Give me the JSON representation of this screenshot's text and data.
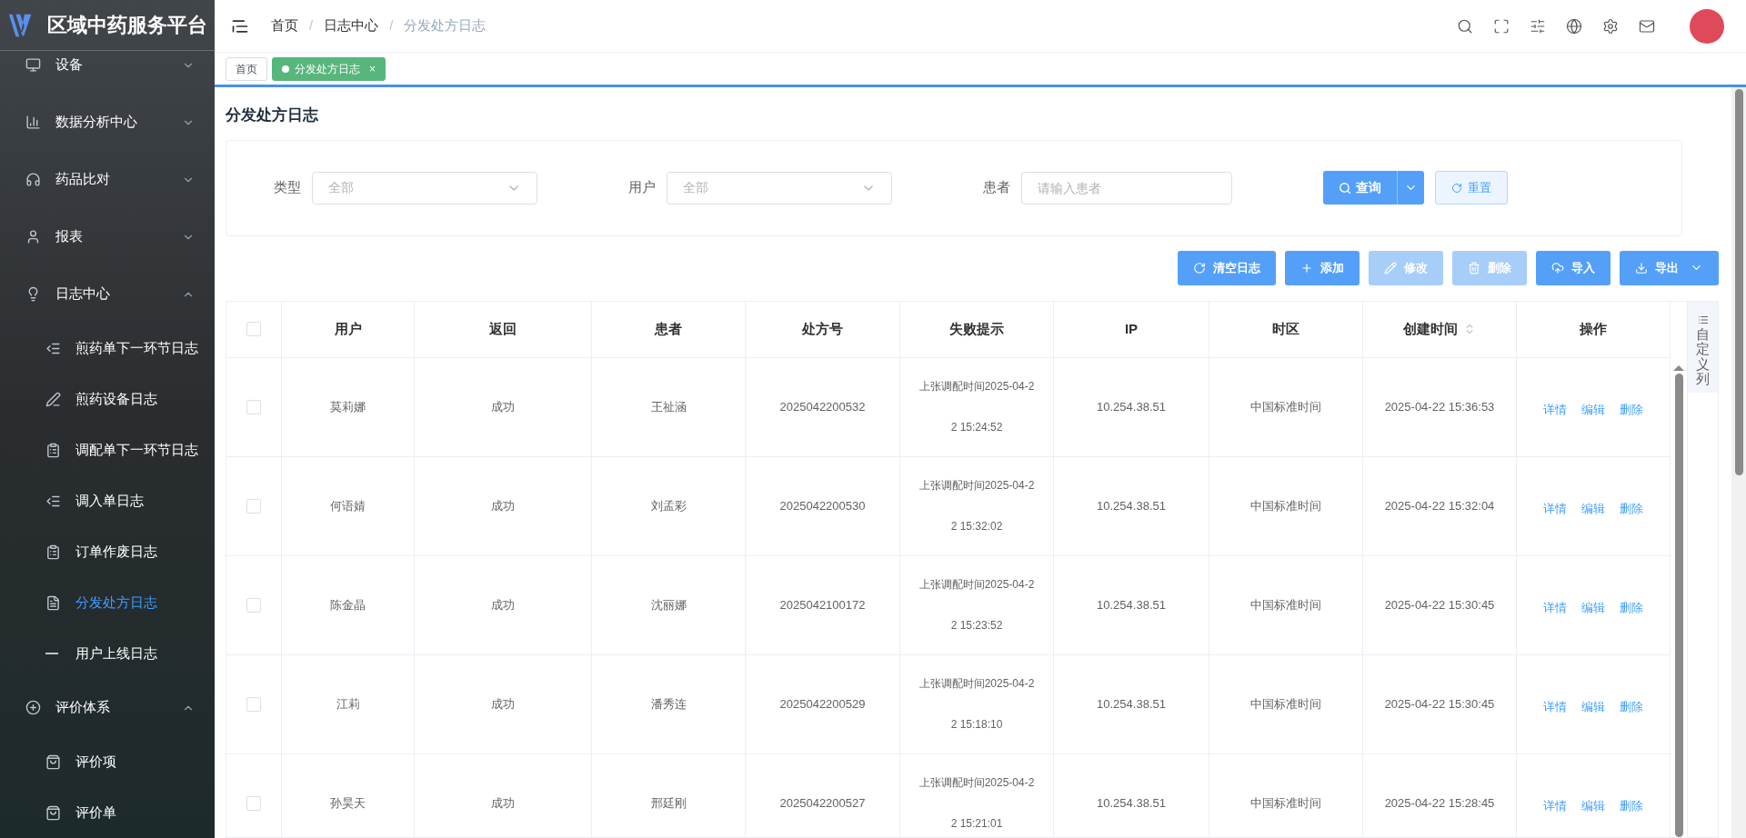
{
  "app": {
    "title": "区域中药服务平台"
  },
  "sidebar": {
    "items": [
      {
        "label": "设备",
        "expanded": false,
        "selected": false
      },
      {
        "label": "数据分析中心",
        "expanded": false,
        "selected": false
      },
      {
        "label": "药品比对",
        "expanded": false,
        "selected": false
      },
      {
        "label": "报表",
        "expanded": false,
        "selected": false
      },
      {
        "label": "日志中心",
        "expanded": true,
        "selected": false,
        "children": [
          {
            "label": "煎药单下一环节日志",
            "selected": false
          },
          {
            "label": "煎药设备日志",
            "selected": false
          },
          {
            "label": "调配单下一环节日志",
            "selected": false
          },
          {
            "label": "调入单日志",
            "selected": false
          },
          {
            "label": "订单作废日志",
            "selected": false
          },
          {
            "label": "分发处方日志",
            "selected": true
          },
          {
            "label": "用户上线日志",
            "selected": false
          }
        ]
      },
      {
        "label": "评价体系",
        "expanded": true,
        "selected": false,
        "children": [
          {
            "label": "评价项",
            "selected": false
          },
          {
            "label": "评价单",
            "selected": false
          }
        ]
      }
    ]
  },
  "breadcrumb": {
    "items": [
      "首页",
      "日志中心",
      "分发处方日志"
    ],
    "separators": [
      "/",
      "/"
    ]
  },
  "tabs": [
    {
      "label": "首页",
      "selected": false
    },
    {
      "label": "分发处方日志",
      "selected": true,
      "close": "×"
    }
  ],
  "page_title": "分发处方日志",
  "filters": [
    {
      "label": "类型",
      "kind": "select",
      "placeholder": "全部"
    },
    {
      "label": "用户",
      "kind": "select",
      "placeholder": "全部"
    },
    {
      "label": "患者",
      "kind": "input",
      "placeholder": "请输入患者"
    }
  ],
  "filter_buttons": {
    "search": "查询",
    "reset": "重置"
  },
  "toolbar": [
    {
      "label": "清空日志",
      "disabled": false,
      "menu": false
    },
    {
      "label": "添加",
      "disabled": false,
      "menu": false
    },
    {
      "label": "修改",
      "disabled": true,
      "menu": false
    },
    {
      "label": "删除",
      "disabled": true,
      "menu": false
    },
    {
      "label": "导入",
      "disabled": false,
      "menu": false
    },
    {
      "label": "导出",
      "disabled": false,
      "menu": true
    }
  ],
  "table": {
    "select_all": false,
    "columns": [
      {
        "label": "用户",
        "sortable": false
      },
      {
        "label": "返回",
        "sortable": false
      },
      {
        "label": "患者",
        "sortable": false
      },
      {
        "label": "处方号",
        "sortable": false
      },
      {
        "label": "失败提示",
        "sortable": false
      },
      {
        "label": "IP",
        "sortable": false
      },
      {
        "label": "时区",
        "sortable": false
      },
      {
        "label": "创建时间",
        "sortable": true
      },
      {
        "label": "操作",
        "sortable": false
      }
    ],
    "rows": [
      {
        "checked": false,
        "cells": [
          "莫莉娜",
          "成功",
          "王祉涵",
          "2025042200532",
          "上张调配时间2025-04-22 15:24:52",
          "10.254.38.51",
          "中国标准时间",
          "2025-04-22 15:36:53"
        ],
        "actions": [
          "详情",
          "编辑",
          "删除"
        ]
      },
      {
        "checked": false,
        "cells": [
          "何语婧",
          "成功",
          "刘孟彩",
          "2025042200530",
          "上张调配时间2025-04-22 15:32:02",
          "10.254.38.51",
          "中国标准时间",
          "2025-04-22 15:32:04"
        ],
        "actions": [
          "详情",
          "编辑",
          "删除"
        ]
      },
      {
        "checked": false,
        "cells": [
          "陈金晶",
          "成功",
          "沈丽娜",
          "2025042100172",
          "上张调配时间2025-04-22 15:23:52",
          "10.254.38.51",
          "中国标准时间",
          "2025-04-22 15:30:45"
        ],
        "actions": [
          "详情",
          "编辑",
          "删除"
        ]
      },
      {
        "checked": false,
        "cells": [
          "江莉",
          "成功",
          "潘秀连",
          "2025042200529",
          "上张调配时间2025-04-22 15:18:10",
          "10.254.38.51",
          "中国标准时间",
          "2025-04-22 15:30:45"
        ],
        "actions": [
          "详情",
          "编辑",
          "删除"
        ]
      },
      {
        "checked": false,
        "cells": [
          "孙昊天",
          "成功",
          "邢廷刚",
          "2025042200527",
          "上张调配时间2025-04-22 15:21:01",
          "10.254.38.51",
          "中国标准时间",
          "2025-04-22 15:28:45"
        ],
        "actions": [
          "详情",
          "编辑",
          "删除"
        ]
      }
    ],
    "column_settings": "自定义列"
  }
}
